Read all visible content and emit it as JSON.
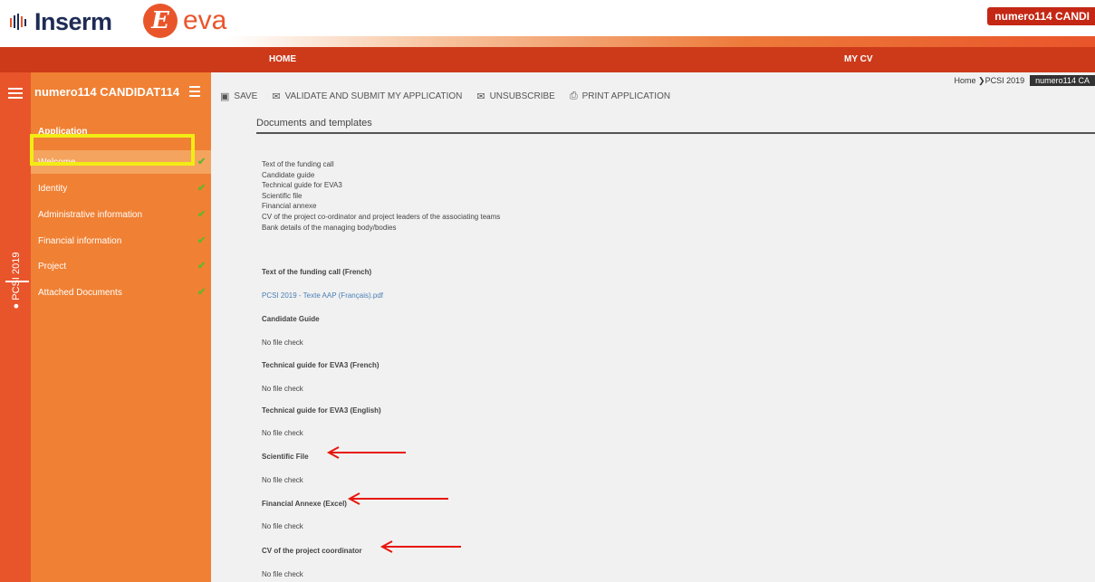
{
  "header": {
    "brand": "Inserm",
    "app_logo_letter": "E",
    "app_name": "eva",
    "user_badge": "numero114 CANDI"
  },
  "nav": {
    "home": "HOME",
    "my_cv": "MY CV"
  },
  "rail": {
    "pcsi_label": "PCSI 2019"
  },
  "sidebar": {
    "user_name": "numero114 CANDIDAT114",
    "section": "Application",
    "items": [
      {
        "label": "Welcome",
        "checked": true
      },
      {
        "label": "Identity",
        "checked": true
      },
      {
        "label": "Administrative information",
        "checked": true
      },
      {
        "label": "Financial information",
        "checked": true
      },
      {
        "label": "Project",
        "checked": true
      },
      {
        "label": "Attached Documents",
        "checked": true
      }
    ],
    "check_mark": "✔"
  },
  "breadcrumb": {
    "path": "Home ❯PCSI 2019",
    "current": "numero114 CA"
  },
  "toolbar": {
    "save": "SAVE",
    "validate": "VALIDATE AND SUBMIT MY APPLICATION",
    "unsubscribe": "UNSUBSCRIBE",
    "print": "PRINT APPLICATION"
  },
  "panel": {
    "title": "Documents and templates",
    "documents": [
      "Text of the funding call",
      "Candidate guide",
      "Technical guide for EVA3",
      "Scientific file",
      "Financial annexe",
      "CV of the project co-ordinator and project leaders of the associating teams",
      "Bank details of the managing body/bodies"
    ],
    "fields": [
      {
        "heading": "Text of the funding call (French)",
        "value": "PCSI 2019 - Texte AAP (Français).pdf",
        "value_is_link": true
      },
      {
        "heading": "Candidate Guide",
        "value": "No file check"
      },
      {
        "heading": "Technical guide for EVA3 (French)",
        "value": "No file check"
      },
      {
        "heading": "Technical guide for EVA3 (English)",
        "value": "No file check"
      },
      {
        "heading": "Scientific File",
        "value": "No file check"
      },
      {
        "heading": "Financial Annexe (Excel)",
        "value": "No file check"
      },
      {
        "heading": "CV of the project coordinator",
        "value": "No file check"
      }
    ]
  },
  "colors": {
    "brand_orange": "#e9552b",
    "nav_red": "#cd3a1a",
    "sidebar_orange": "#f08033",
    "highlight_yellow": "#f2ec14",
    "annotation_red": "#e8160c",
    "check_green": "#5cb82e"
  }
}
